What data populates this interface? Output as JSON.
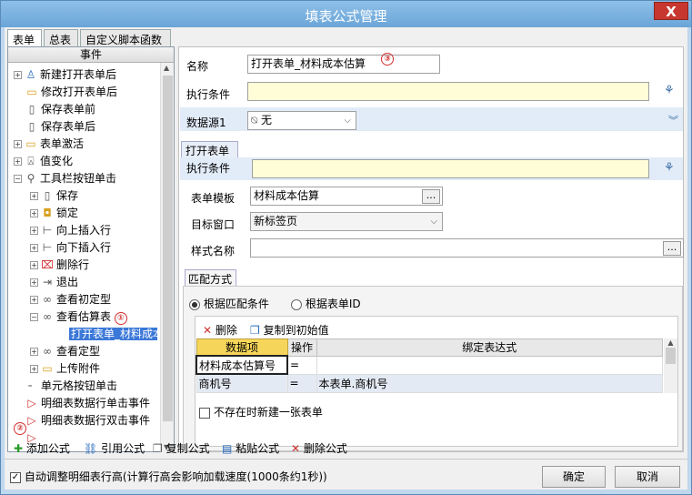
{
  "window": {
    "title": "填表公式管理",
    "close_label": "X"
  },
  "tabs": [
    "表单",
    "总表",
    "自定义脚本函数"
  ],
  "left": {
    "header": "事件",
    "nodes": [
      {
        "label": "新建打开表单后",
        "expander": "+",
        "icon": "user-icon"
      },
      {
        "label": "修改打开表单后",
        "expander": "",
        "icon": "folder-icon"
      },
      {
        "label": "保存表单前",
        "expander": "",
        "icon": "doc-icon"
      },
      {
        "label": "保存表单后",
        "expander": "",
        "icon": "doc-icon"
      },
      {
        "label": "表单激活",
        "expander": "+",
        "icon": "folder-icon"
      },
      {
        "label": "值变化",
        "expander": "+",
        "icon": "value-icon"
      },
      {
        "label": "工具栏按钮单击",
        "expander": "-",
        "icon": "tool-icon"
      },
      {
        "label": "保存",
        "expander": "+",
        "icon": "save-icon"
      },
      {
        "label": "锁定",
        "expander": "+",
        "icon": "lock-icon"
      },
      {
        "label": "向上插入行",
        "expander": "+",
        "icon": "insert-up-icon"
      },
      {
        "label": "向下插入行",
        "expander": "+",
        "icon": "insert-down-icon"
      },
      {
        "label": "删除行",
        "expander": "+",
        "icon": "delete-row-icon"
      },
      {
        "label": "退出",
        "expander": "+",
        "icon": "exit-icon"
      },
      {
        "label": "查看初定型",
        "expander": "+",
        "icon": "binoculars-icon"
      },
      {
        "label": "查看估算表",
        "expander": "-",
        "icon": "binoculars-icon"
      },
      {
        "label": "打开表单_材料成本",
        "expander": "",
        "icon": ""
      },
      {
        "label": "查看定型",
        "expander": "+",
        "icon": "binoculars-icon"
      },
      {
        "label": "上传附件",
        "expander": "+",
        "icon": "folder-icon"
      },
      {
        "label": "单元格按钮单击",
        "expander": "",
        "icon": ""
      },
      {
        "label": "明细表数据行单击事件",
        "expander": "",
        "icon": "flag-icon"
      },
      {
        "label": "明细表数据行双击事件",
        "expander": "",
        "icon": "flag-icon"
      }
    ],
    "markers": {
      "one": "①",
      "two": "②",
      "three": "③"
    }
  },
  "right": {
    "name_label": "名称",
    "name_value": "打开表单_材料成本估算",
    "cond_label": "执行条件",
    "ds_label": "数据源1",
    "ds_value": "无",
    "open_tab": "打开表单",
    "cond2_label": "执行条件",
    "template_label": "表单模板",
    "template_value": "材料成本估算",
    "target_label": "目标窗口",
    "target_value": "新标签页",
    "style_label": "样式名称",
    "style_value": "",
    "match_tab": "匹配方式",
    "radio1": "根据匹配条件",
    "radio2": "根据表单ID",
    "delete_label": "删除",
    "copy_label": "复制到初始值",
    "grid": {
      "headers": [
        "数据项",
        "操作",
        "绑定表达式"
      ],
      "rows": [
        [
          "材料成本估算号",
          "=",
          ""
        ],
        [
          "商机号",
          "=",
          "本表单.商机号"
        ]
      ]
    },
    "checkbox_label": "不存在时新建一张表单",
    "dots": "..."
  },
  "bottom_toolbar": [
    "添加公式",
    "引用公式",
    "复制公式",
    "粘贴公式",
    "删除公式"
  ],
  "footer": {
    "auto_label": "自动调整明细表行高(计算行高会影响加载速度(1000条约1秒))",
    "ok": "确定",
    "cancel": "取消"
  },
  "colors": {
    "title_bar": "#6aa5d8",
    "selection": "#3b78d8",
    "yellow_input": "#fefdd8",
    "marker_red": "#d03030"
  }
}
